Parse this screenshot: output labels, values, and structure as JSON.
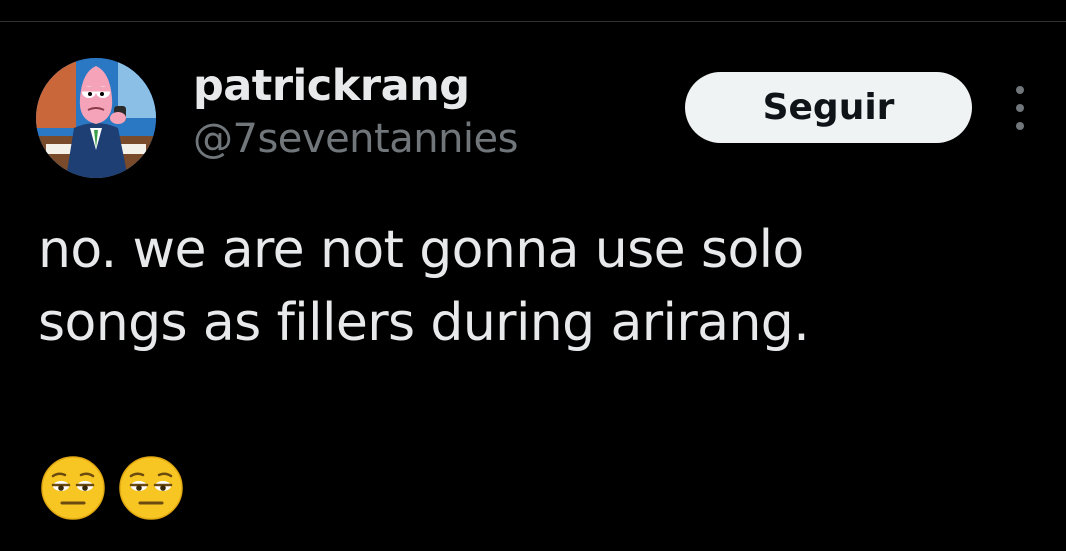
{
  "author": {
    "display_name": "patrickrang",
    "handle": "@7seventannies",
    "avatar": "patrick-star-avatar-icon"
  },
  "actions": {
    "follow_label": "Seguir",
    "more_icon": "more-options-icon"
  },
  "tweet": {
    "lines": [
      "no. we are not gonna use solo",
      "songs as fillers during arirang."
    ],
    "emojis": [
      "unamused-face-icon",
      "unamused-face-icon"
    ]
  },
  "colors": {
    "background": "#000000",
    "text_primary": "#e7e9ea",
    "text_secondary": "#71767b",
    "follow_button_bg": "#eff3f4",
    "divider": "#2f3336"
  }
}
